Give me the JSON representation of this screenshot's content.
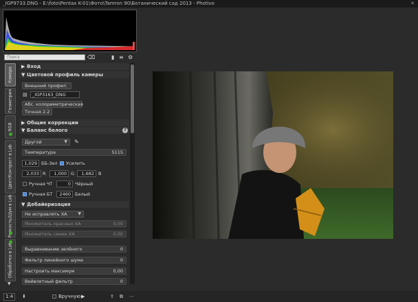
{
  "window": {
    "title": "_IGP9733.DNG - E:\\foto\\Pentax K-01\\Фото\\Tamron 90\\Ботанический сад 2013 - Photivo",
    "close_glyph": "✕"
  },
  "search": {
    "placeholder": "Поиск"
  },
  "tabs": [
    {
      "label": "Камера"
    },
    {
      "label": "Геометрия"
    },
    {
      "label": "RGB"
    },
    {
      "label": "Цвет/Контраст в Lab"
    },
    {
      "label": "Резкость/Шум в Lab"
    },
    {
      "label": "Обработка в Lab"
    }
  ],
  "sections": {
    "input": "Вход",
    "camera_profile": "Цветовой профиль камеры",
    "general_corrections": "Общие коррекции",
    "white_balance": "Баланс белого",
    "demosaic": "Дебайеризация"
  },
  "controls": {
    "external_profile": "Внешний профиль",
    "profile_file": "_IGP3163_DNG",
    "intent": "Абс. колориметрическая",
    "gamma": "Точная 2.2",
    "wb_preset": "Другой",
    "temperature_label": "Температура",
    "temperature_value": "5115",
    "green_value": "1,029",
    "green_label": "ББ-Зел",
    "amplify_label": "Усилить",
    "r_value": "2,033",
    "r_label": "R",
    "g_value": "1,000",
    "g_label": "G",
    "b_value": "1,682",
    "b_label": "B",
    "manual_bp_label": "Ручная ЧТ",
    "manual_bp_value": "0",
    "black_label": "Чёрный",
    "manual_wp_label": "Ручная БТ",
    "manual_wp_value": "2460",
    "white_label": "Белый",
    "ca_correction": "Не исправлять ХА",
    "red_ca_label": "Множитель красных ХА",
    "red_ca_value": "0,00",
    "blue_ca_label": "Множитель синих ХА",
    "blue_ca_value": "0,00",
    "green_eq_label": "Выравнивание зелёного",
    "green_eq_value": "0",
    "line_noise_label": "Фильтр линейного шума",
    "line_noise_value": "0",
    "max_adjust_label": "Настроить максимум",
    "max_adjust_value": "0,00",
    "wavelet_label": "Вейвлетный фильтр",
    "wavelet_value": "0"
  },
  "bottom": {
    "zoom": "1:4",
    "manual_label": "Вручную"
  },
  "colors": {
    "accent_blue": "#4d86d8",
    "tab_dot": "#3fae2a"
  }
}
